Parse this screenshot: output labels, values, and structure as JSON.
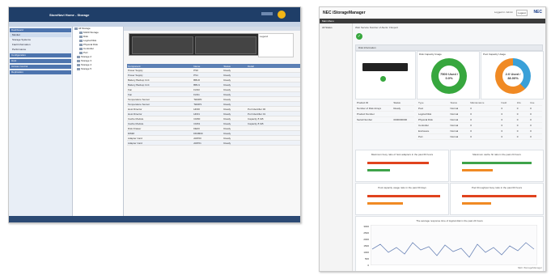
{
  "left_app": {
    "title_text": "StoreNavi Home - Storage",
    "nav_items": [
      {
        "label": "Dashboard",
        "header": true
      },
      {
        "label": "Monitor",
        "header": false,
        "selected": true
      },
      {
        "label": "Storage Systems",
        "header": false
      },
      {
        "label": "Fault Information",
        "header": false
      },
      {
        "label": "Performance",
        "header": false
      },
      {
        "label": "Configuration",
        "header": true
      },
      {
        "label": "Host",
        "header": true
      },
      {
        "label": "Access Control",
        "header": true
      },
      {
        "label": "Replication",
        "header": true
      }
    ],
    "tree_nodes": [
      "All Storage",
      "M100 Storage",
      "Disk",
      "Logical Disk",
      "Physical Disk",
      "Controller",
      "Port",
      "Storage 2",
      "Storage 3",
      "Storage 4",
      "Storage 5"
    ],
    "legend_title": "Legend",
    "table": {
      "headers": [
        "Component",
        "Name",
        "Status",
        "Detail"
      ],
      "rows": [
        [
          "Power Supply",
          "PS0",
          "Ready",
          ""
        ],
        [
          "Power Supply",
          "PS1",
          "Ready",
          ""
        ],
        [
          "Battery Backup Unit",
          "BBU0",
          "Ready",
          ""
        ],
        [
          "Battery Backup Unit",
          "BBU1",
          "Ready",
          ""
        ],
        [
          "Fan",
          "FAN0",
          "Ready",
          ""
        ],
        [
          "Fan",
          "FAN1",
          "Ready",
          ""
        ],
        [
          "Temperature Sensor",
          "TEMP0",
          "Ready",
          ""
        ],
        [
          "Temperature Sensor",
          "TEMP1",
          "Ready",
          ""
        ],
        [
          "Host Director",
          "HD00",
          "Ready",
          "Port Identifier 00"
        ],
        [
          "Host Director",
          "HD01",
          "Ready",
          "Port Identifier 01"
        ],
        [
          "Cache Module",
          "CM00",
          "Ready",
          "Capacity 8 GB"
        ],
        [
          "Cache Module",
          "CM01",
          "Ready",
          "Capacity 8 GB"
        ],
        [
          "Disk Drawer",
          "DE00",
          "Ready",
          ""
        ],
        [
          "DIMM",
          "DIMM00",
          "Ready",
          ""
        ],
        [
          "Adapter Card",
          "ADP00",
          "Ready",
          ""
        ],
        [
          "Adapter Card",
          "ADP01",
          "Ready",
          ""
        ]
      ]
    }
  },
  "right_app": {
    "title": "NEC iStorageManager",
    "user_info": "Logged in: Admin",
    "logout": "Logout",
    "brand": "NEC",
    "subbar": "Main Menu",
    "side_item": "All Status",
    "tabs": "Web Service    Number of Alerts: 0    Export",
    "section_title": "Disk Information",
    "ring1_label": "Disk Capacity Usage",
    "ring1_text": "7500 Used / 0.0%",
    "ring2_label": "Pool Capacity Usage",
    "ring2_text": "2.0 Used / 38.00%",
    "ring_colors": {
      "ring1": "#37a73e",
      "ring2_a": "#f08a24",
      "ring2_b": "#3aa0d8"
    },
    "info_rows": [
      [
        "Product ID",
        "Status"
      ],
      [
        "Number of Disk Arrays",
        "Ready"
      ],
      [
        "Product Number",
        ""
      ],
      [
        "Serial Number",
        "0000000000"
      ]
    ],
    "status_table": {
      "headers": [
        "Type",
        "Status",
        "Maintenance",
        "Fault",
        "Info",
        "Use"
      ],
      "rows": [
        [
          "Pool",
          "Normal",
          "0",
          "0",
          "0",
          "0"
        ],
        [
          "Logical Disk",
          "Normal",
          "0",
          "0",
          "0",
          "0"
        ],
        [
          "Physical Disk",
          "Normal",
          "0",
          "0",
          "0",
          "0"
        ],
        [
          "Controller",
          "Normal",
          "0",
          "0",
          "0",
          "0"
        ],
        [
          "Enclosure",
          "Normal",
          "0",
          "0",
          "0",
          "0"
        ],
        [
          "Port",
          "Normal",
          "0",
          "0",
          "0",
          "0"
        ]
      ]
    },
    "bar_chart_titles": [
      "Maximum busy ratio of host adapters in the past 60 hours",
      "Maximum cache hit ratio in the past 24 hours",
      "Pool capacity usage ratio in the past 60 days",
      "Pool throughput busy ratio in the past 60 hours"
    ],
    "line_chart_title": "The average response time of logical disk in the past 24 hours",
    "line_y_ticks": [
      "3000",
      "2500",
      "2000",
      "1500",
      "1000",
      "500",
      "0"
    ],
    "footer": "NEC iStorageManager"
  }
}
